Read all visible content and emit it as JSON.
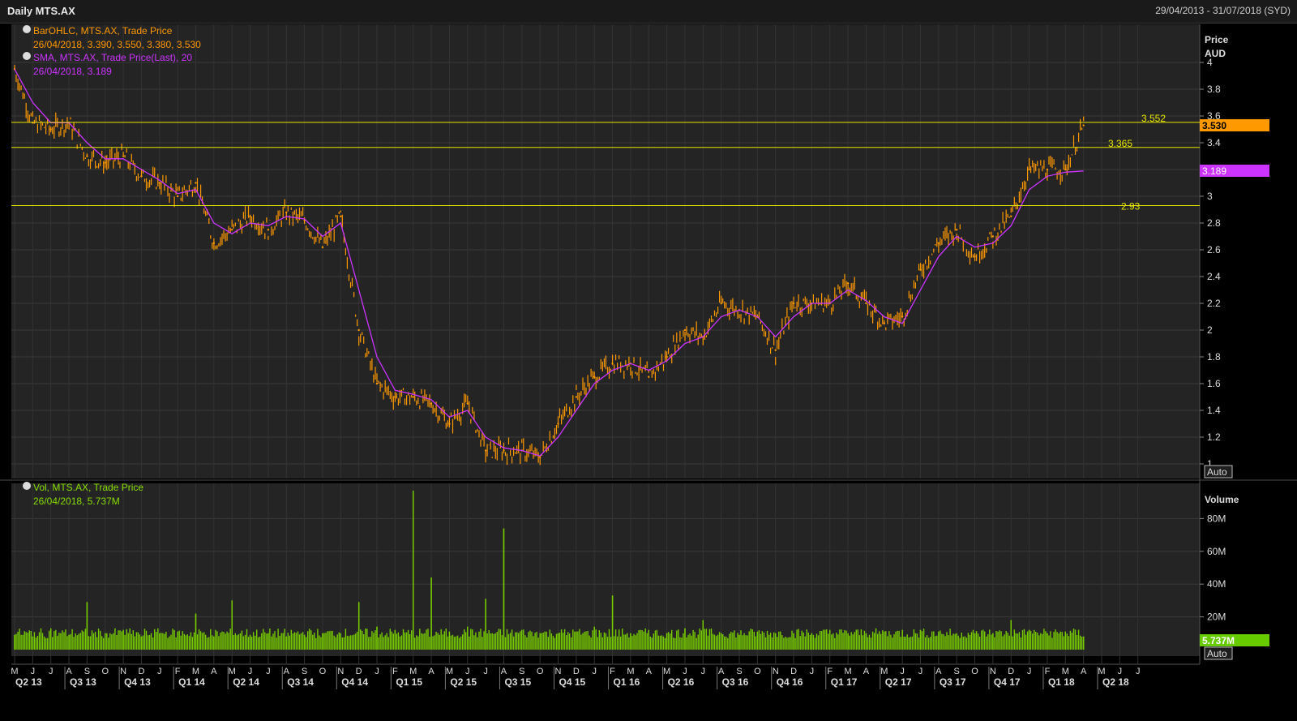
{
  "header": {
    "title": "Daily MTS.AX",
    "date_range": "29/04/2013 - 31/07/2018 (SYD)"
  },
  "price_panel": {
    "axis_title_1": "Price",
    "axis_title_2": "AUD",
    "auto_label": "Auto",
    "legend": [
      {
        "label": "BarOHLC, MTS.AX, Trade Price",
        "value": "26/04/2018, 3.390, 3.550, 3.380, 3.530",
        "color": "#ff9900"
      },
      {
        "label": "SMA, MTS.AX, Trade Price(Last), 20",
        "value": "26/04/2018, 3.189",
        "color": "#cc33ff"
      }
    ],
    "last_price_tag": "3.530",
    "sma_tag": "3.189",
    "hlines": [
      {
        "label": "3.552",
        "value": 3.552
      },
      {
        "label": "3.365",
        "value": 3.365
      },
      {
        "label": "2.93",
        "value": 2.93
      }
    ]
  },
  "volume_panel": {
    "axis_title": "Volume",
    "auto_label": "Auto",
    "legend": {
      "label": "Vol, MTS.AX, Trade Price",
      "value": "26/04/2018, 5.737M",
      "color": "#88dd00"
    },
    "last_volume_tag": "5.737M"
  },
  "x_axis": {
    "months": [
      "M",
      "J",
      "J",
      "A",
      "S",
      "O",
      "N",
      "D",
      "J",
      "F",
      "M",
      "A",
      "M",
      "J",
      "J",
      "A",
      "S",
      "O",
      "N",
      "D",
      "J",
      "F",
      "M",
      "A",
      "M",
      "J",
      "J",
      "A",
      "S",
      "O",
      "N",
      "D",
      "J",
      "F",
      "M",
      "A",
      "M",
      "J",
      "J",
      "A",
      "S",
      "O",
      "N",
      "D",
      "J",
      "F",
      "M",
      "A",
      "M",
      "J",
      "J",
      "A",
      "S",
      "O",
      "N",
      "D",
      "J",
      "F",
      "M",
      "A",
      "M",
      "J",
      "J"
    ],
    "quarters": [
      "Q2 13",
      "Q3 13",
      "Q4 13",
      "Q1 14",
      "Q2 14",
      "Q3 14",
      "Q4 14",
      "Q1 15",
      "Q2 15",
      "Q3 15",
      "Q4 15",
      "Q1 16",
      "Q2 16",
      "Q3 16",
      "Q4 16",
      "Q1 17",
      "Q2 17",
      "Q3 17",
      "Q4 17",
      "Q1 18",
      "Q2 18"
    ]
  },
  "chart_data": [
    {
      "type": "line",
      "title": "Daily MTS.AX",
      "ylabel": "Price AUD",
      "ylim": [
        1.0,
        4.1
      ],
      "y_ticks": [
        "1",
        "1.2",
        "1.4",
        "1.6",
        "1.8",
        "2",
        "2.2",
        "2.4",
        "2.6",
        "2.8",
        "3",
        "3.2",
        "3.4",
        "3.6",
        "3.8",
        "4"
      ],
      "x": [
        "2013-05",
        "2013-06",
        "2013-07",
        "2013-08",
        "2013-09",
        "2013-10",
        "2013-11",
        "2013-12",
        "2014-01",
        "2014-02",
        "2014-03",
        "2014-04",
        "2014-05",
        "2014-06",
        "2014-07",
        "2014-08",
        "2014-09",
        "2014-10",
        "2014-11",
        "2014-12",
        "2015-01",
        "2015-02",
        "2015-03",
        "2015-04",
        "2015-05",
        "2015-06",
        "2015-07",
        "2015-08",
        "2015-09",
        "2015-10",
        "2015-11",
        "2015-12",
        "2016-01",
        "2016-02",
        "2016-03",
        "2016-04",
        "2016-05",
        "2016-06",
        "2016-07",
        "2016-08",
        "2016-09",
        "2016-10",
        "2016-11",
        "2016-12",
        "2017-01",
        "2017-02",
        "2017-03",
        "2017-04",
        "2017-05",
        "2017-06",
        "2017-07",
        "2017-08",
        "2017-09",
        "2017-10",
        "2017-11",
        "2017-12",
        "2018-01",
        "2018-02",
        "2018-03",
        "2018-04"
      ],
      "series": [
        {
          "name": "BarOHLC, MTS.AX, Trade Price",
          "color": "#ff9900",
          "values": [
            3.95,
            3.55,
            3.5,
            3.55,
            3.3,
            3.25,
            3.3,
            3.15,
            3.1,
            3.0,
            3.1,
            2.65,
            2.75,
            2.85,
            2.75,
            2.88,
            2.82,
            2.62,
            2.85,
            2.0,
            1.6,
            1.5,
            1.5,
            1.45,
            1.3,
            1.45,
            1.1,
            1.1,
            1.1,
            1.05,
            1.3,
            1.5,
            1.65,
            1.75,
            1.75,
            1.65,
            1.8,
            2.0,
            1.95,
            2.2,
            2.15,
            2.1,
            1.85,
            2.2,
            2.2,
            2.2,
            2.35,
            2.2,
            2.05,
            2.1,
            2.45,
            2.65,
            2.75,
            2.55,
            2.7,
            2.85,
            3.2,
            3.2,
            3.2,
            3.53
          ]
        },
        {
          "name": "SMA, MTS.AX, Trade Price(Last), 20",
          "color": "#cc33ff",
          "values": [
            3.95,
            3.7,
            3.55,
            3.55,
            3.4,
            3.28,
            3.28,
            3.2,
            3.12,
            3.02,
            3.05,
            2.8,
            2.72,
            2.8,
            2.78,
            2.85,
            2.83,
            2.7,
            2.8,
            2.3,
            1.8,
            1.55,
            1.52,
            1.48,
            1.35,
            1.4,
            1.2,
            1.12,
            1.1,
            1.06,
            1.2,
            1.4,
            1.6,
            1.7,
            1.75,
            1.7,
            1.77,
            1.9,
            1.95,
            2.1,
            2.15,
            2.1,
            1.95,
            2.1,
            2.2,
            2.2,
            2.3,
            2.22,
            2.1,
            2.05,
            2.3,
            2.55,
            2.7,
            2.62,
            2.65,
            2.78,
            3.05,
            3.15,
            3.18,
            3.189
          ]
        }
      ]
    },
    {
      "type": "bar",
      "title": "Vol, MTS.AX, Trade Price",
      "ylabel": "Volume",
      "ylim": [
        0,
        95
      ],
      "y_ticks": [
        "20M",
        "40M",
        "60M",
        "80M"
      ],
      "x": [
        "2013-05",
        "2013-06",
        "2013-07",
        "2013-08",
        "2013-09",
        "2013-10",
        "2013-11",
        "2013-12",
        "2014-01",
        "2014-02",
        "2014-03",
        "2014-04",
        "2014-05",
        "2014-06",
        "2014-07",
        "2014-08",
        "2014-09",
        "2014-10",
        "2014-11",
        "2014-12",
        "2015-01",
        "2015-02",
        "2015-03",
        "2015-04",
        "2015-05",
        "2015-06",
        "2015-07",
        "2015-08",
        "2015-09",
        "2015-10",
        "2015-11",
        "2015-12",
        "2016-01",
        "2016-02",
        "2016-03",
        "2016-04",
        "2016-05",
        "2016-06",
        "2016-07",
        "2016-08",
        "2016-09",
        "2016-10",
        "2016-11",
        "2016-12",
        "2017-01",
        "2017-02",
        "2017-03",
        "2017-04",
        "2017-05",
        "2017-06",
        "2017-07",
        "2017-08",
        "2017-09",
        "2017-10",
        "2017-11",
        "2017-12",
        "2018-01",
        "2018-02",
        "2018-03",
        "2018-04"
      ],
      "series": [
        {
          "name": "Vol, MTS.AX, Trade Price",
          "color": "#77cc00",
          "values": [
            9,
            8,
            13,
            9,
            29,
            10,
            12,
            8,
            10,
            11,
            22,
            8,
            30,
            9,
            10,
            8,
            9,
            10,
            10,
            29,
            14,
            12,
            97,
            44,
            11,
            14,
            31,
            74,
            12,
            10,
            10,
            11,
            14,
            33,
            10,
            12,
            10,
            13,
            18,
            10,
            9,
            11,
            10,
            10,
            10,
            12,
            10,
            10,
            11,
            12,
            12,
            11,
            10,
            10,
            10,
            18,
            12,
            10,
            11,
            8
          ]
        }
      ]
    }
  ]
}
